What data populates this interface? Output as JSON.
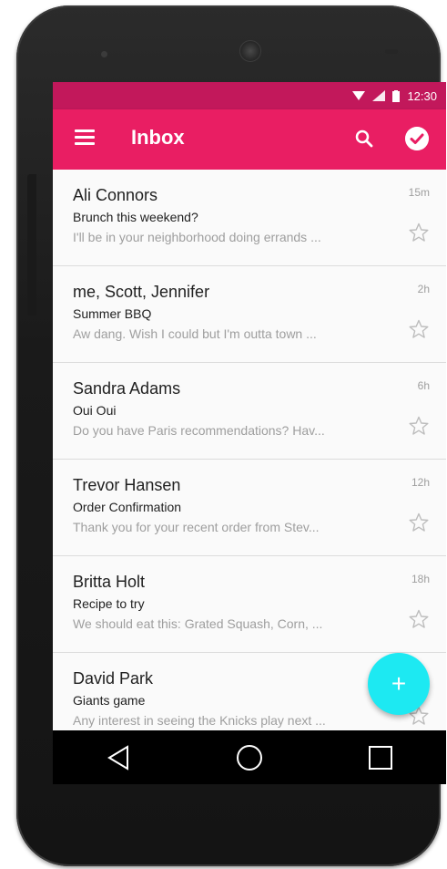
{
  "status": {
    "time": "12:30"
  },
  "appbar": {
    "title": "Inbox"
  },
  "messages": [
    {
      "sender": "Ali Connors",
      "subject": "Brunch this weekend?",
      "preview": "I'll be in your neighborhood doing errands ...",
      "time": "15m"
    },
    {
      "sender": "me, Scott, Jennifer",
      "subject": "Summer BBQ",
      "preview": "Aw dang. Wish I could but I'm outta town ...",
      "time": "2h"
    },
    {
      "sender": "Sandra Adams",
      "subject": "Oui Oui",
      "preview": "Do you have Paris recommendations? Hav...",
      "time": "6h"
    },
    {
      "sender": "Trevor Hansen",
      "subject": "Order Confirmation",
      "preview": "Thank you for your recent order from Stev...",
      "time": "12h"
    },
    {
      "sender": "Britta Holt",
      "subject": "Recipe to try",
      "preview": "We should eat this: Grated Squash, Corn, ...",
      "time": "18h"
    },
    {
      "sender": "David Park",
      "subject": "Giants game",
      "preview": "Any interest in seeing the Knicks play next ...",
      "time": ""
    }
  ],
  "fab": {
    "label": "+"
  },
  "colors": {
    "primary": "#e91e63",
    "primary_dark": "#c2185b",
    "accent": "#1de9f2"
  },
  "icons": [
    "menu-icon",
    "search-icon",
    "check-icon",
    "star-icon",
    "back-icon",
    "home-icon",
    "recents-icon"
  ]
}
